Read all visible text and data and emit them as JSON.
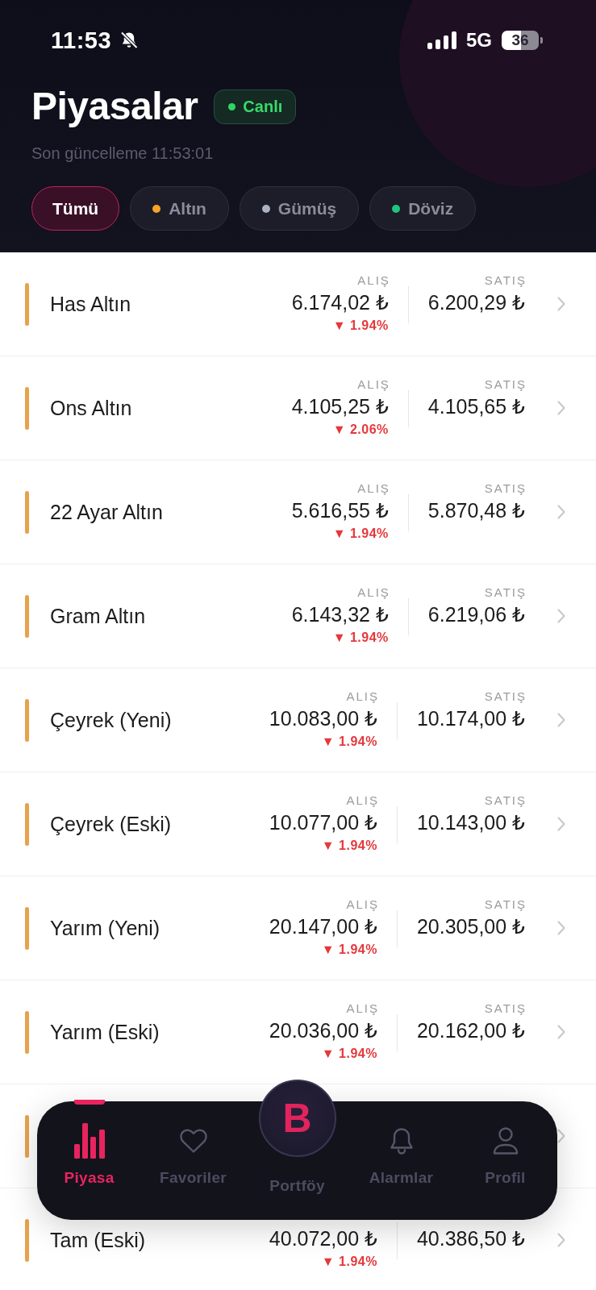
{
  "status_bar": {
    "time": "11:53",
    "network": "5G",
    "battery": "36"
  },
  "header": {
    "title": "Piyasalar",
    "live_badge": "Canlı",
    "last_update": "Son güncelleme 11:53:01"
  },
  "filters": [
    {
      "label": "Tümü",
      "selected": true
    },
    {
      "label": "Altın",
      "selected": false,
      "color": "#f5a524"
    },
    {
      "label": "Gümüş",
      "selected": false,
      "color": "#a9b3c4"
    },
    {
      "label": "Döviz",
      "selected": false,
      "color": "#1fc47d"
    }
  ],
  "rows": [
    {
      "name": "Has Altın",
      "buy_label": "ALIŞ",
      "buy": "6.174,02 ₺",
      "change": "▼ 1.94%",
      "sell_label": "SATIŞ",
      "sell": "6.200,29 ₺"
    },
    {
      "name": "Ons Altın",
      "buy_label": "ALIŞ",
      "buy": "4.105,25 ₺",
      "change": "▼ 2.06%",
      "sell_label": "SATIŞ",
      "sell": "4.105,65 ₺"
    },
    {
      "name": "22 Ayar Altın",
      "buy_label": "ALIŞ",
      "buy": "5.616,55 ₺",
      "change": "▼ 1.94%",
      "sell_label": "SATIŞ",
      "sell": "5.870,48 ₺"
    },
    {
      "name": "Gram Altın",
      "buy_label": "ALIŞ",
      "buy": "6.143,32 ₺",
      "change": "▼ 1.94%",
      "sell_label": "SATIŞ",
      "sell": "6.219,06 ₺"
    },
    {
      "name": "Çeyrek (Yeni)",
      "buy_label": "ALIŞ",
      "buy": "10.083,00 ₺",
      "change": "▼ 1.94%",
      "sell_label": "SATIŞ",
      "sell": "10.174,00 ₺"
    },
    {
      "name": "Çeyrek (Eski)",
      "buy_label": "ALIŞ",
      "buy": "10.077,00 ₺",
      "change": "▼ 1.94%",
      "sell_label": "SATIŞ",
      "sell": "10.143,00 ₺"
    },
    {
      "name": "Yarım (Yeni)",
      "buy_label": "ALIŞ",
      "buy": "20.147,00 ₺",
      "change": "▼ 1.94%",
      "sell_label": "SATIŞ",
      "sell": "20.305,00 ₺"
    },
    {
      "name": "Yarım (Eski)",
      "buy_label": "ALIŞ",
      "buy": "20.036,00 ₺",
      "change": "▼ 1.94%",
      "sell_label": "SATIŞ",
      "sell": "20.162,00 ₺"
    },
    {},
    {
      "name": "Tam (Eski)",
      "buy": "40.072,00 ₺",
      "change": "▼ 1.94%",
      "sell": "40.386,50 ₺"
    }
  ],
  "bottom_nav": {
    "logo": "B",
    "items": [
      {
        "label": "Piyasa",
        "kind": "tab",
        "selected": true
      },
      {
        "label": "Favoriler",
        "kind": "tab",
        "selected": false
      },
      {
        "label": "Portföy",
        "kind": "center",
        "selected": false
      },
      {
        "label": "Alarmlar",
        "kind": "tab",
        "selected": false
      },
      {
        "label": "Profil",
        "kind": "tab",
        "selected": false
      }
    ]
  }
}
